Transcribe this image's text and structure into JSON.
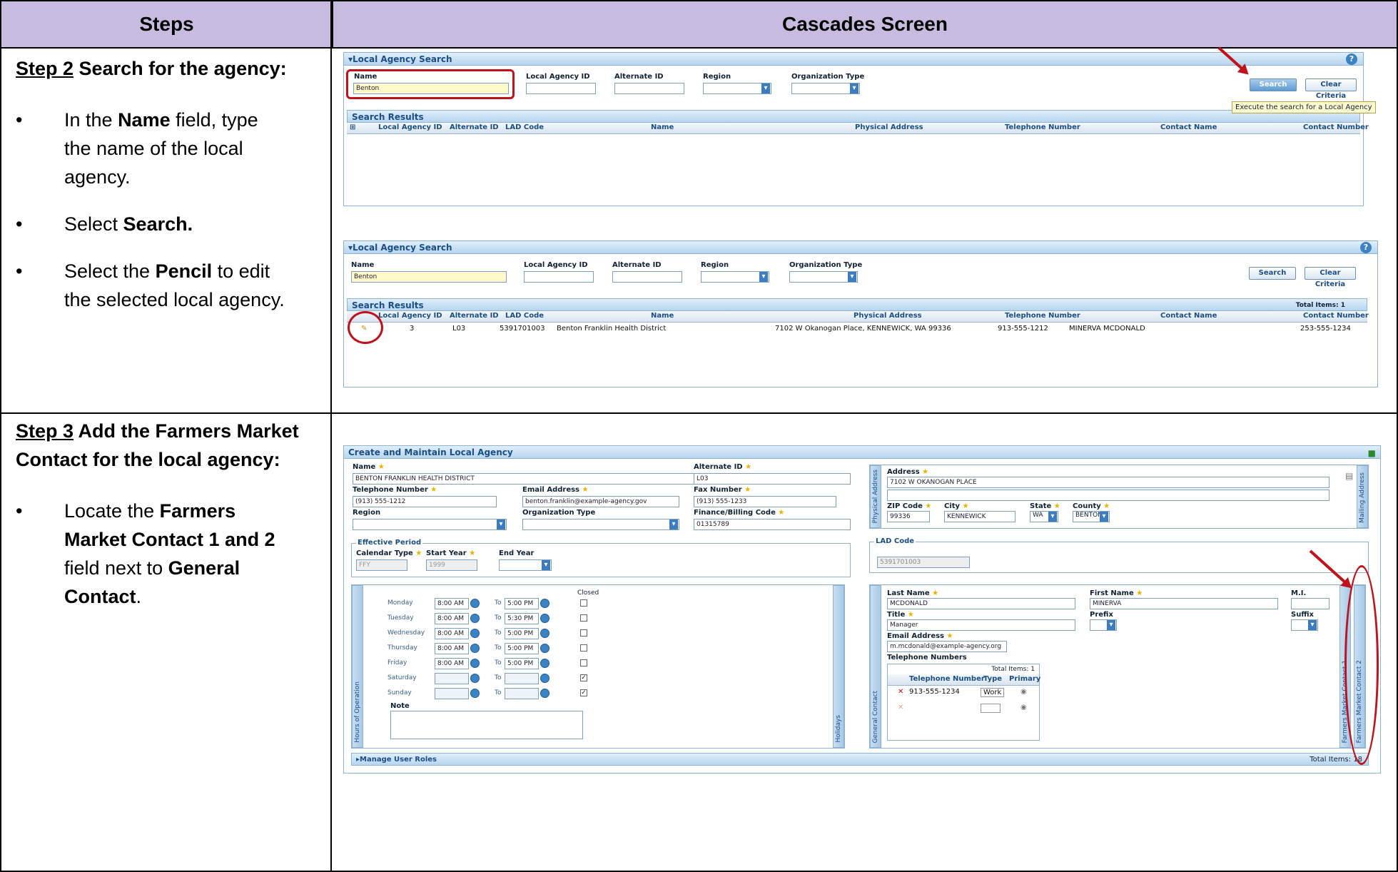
{
  "headers": {
    "steps": "Steps",
    "screen": "Cascades Screen"
  },
  "step2": {
    "label": "Step 2",
    "title": " Search for the agency:",
    "bullets": [
      {
        "pre": "In the ",
        "bold": "Name",
        "post": " field, type the name of the local agency."
      },
      {
        "pre": "Select ",
        "bold": "Search.",
        "post": ""
      },
      {
        "pre": "Select the ",
        "bold": "Pencil",
        "post": " to edit the selected local agency."
      }
    ]
  },
  "step3": {
    "label": "Step 3",
    "title": " Add the Farmers Market Contact for the local agency:",
    "bullet": {
      "pre": "Locate the ",
      "bold1": "Farmers Market Contact 1 and 2",
      "mid": " field next to ",
      "bold2": "General Contact",
      "post": "."
    }
  },
  "search_panel": {
    "title": "▾Local Agency Search",
    "help": "?",
    "labels": {
      "name": "Name",
      "agency_id": "Local Agency ID",
      "alt_id": "Alternate ID",
      "region": "Region",
      "org_type": "Organization Type"
    },
    "name_value": "Benton",
    "search_btn": "Search",
    "clear_btn": "Clear Criteria",
    "results_title": "Search Results",
    "tooltip": "Execute the search for a Local Agency",
    "columns": [
      "Local Agency ID",
      "Alternate ID",
      "LAD Code",
      "Name",
      "Physical Address",
      "Telephone Number",
      "Contact Name",
      "Contact Number"
    ],
    "total": "Total Items: 1",
    "row": {
      "id": "3",
      "alt": "L03",
      "lad": "5391701003",
      "name": "Benton Franklin Health District",
      "address": "7102 W Okanogan Place, KENNEWICK, WA 99336",
      "phone": "913-555-1212",
      "contact": "MINERVA MCDONALD",
      "contact_no": "253-555-1234"
    }
  },
  "maintain": {
    "title": "Create and Maintain Local Agency",
    "name_lbl": "Name",
    "name_val": "BENTON FRANKLIN HEALTH DISTRICT",
    "alt_lbl": "Alternate ID",
    "alt_val": "L03",
    "tel_lbl": "Telephone Number",
    "tel_val": "(913) 555-1212",
    "email_lbl": "Email Address",
    "email_val": "benton.franklin@example-agency.gov",
    "fax_lbl": "Fax Number",
    "fax_val": "(913) 555-1233",
    "region_lbl": "Region",
    "org_lbl": "Organization Type",
    "fin_lbl": "Finance/Billing Code",
    "fin_val": "01315789",
    "eff_lbl": "Effective Period",
    "cal_lbl": "Calendar Type",
    "cal_val": "FFY",
    "start_lbl": "Start Year",
    "start_val": "1999",
    "end_lbl": "End Year",
    "addr_lbl": "Address",
    "addr_val": "7102 W OKANOGAN PLACE",
    "zip_lbl": "ZIP Code",
    "zip_val": "99336",
    "city_lbl": "City",
    "city_val": "KENNEWICK",
    "state_lbl": "State",
    "state_val": "WA",
    "county_lbl": "County",
    "county_val": "BENTON",
    "phys_tab": "Physical Address",
    "mail_tab": "Mailing Address",
    "lad_lbl": "LAD Code",
    "lad_val": "5391701003",
    "hours_tab": "Hours of Operation",
    "holidays_tab": "Holidays",
    "closed_lbl": "Closed",
    "to": "To",
    "note_lbl": "Note",
    "days": [
      {
        "day": "Monday",
        "from": "8:00 AM",
        "to": "5:00 PM",
        "closed": ""
      },
      {
        "day": "Tuesday",
        "from": "8:00 AM",
        "to": "5:30 PM",
        "closed": ""
      },
      {
        "day": "Wednesday",
        "from": "8:00 AM",
        "to": "5:00 PM",
        "closed": ""
      },
      {
        "day": "Thursday",
        "from": "8:00 AM",
        "to": "5:00 PM",
        "closed": ""
      },
      {
        "day": "Friday",
        "from": "8:00 AM",
        "to": "5:00 PM",
        "closed": ""
      },
      {
        "day": "Saturday",
        "from": "",
        "to": "",
        "closed": "✓"
      },
      {
        "day": "Sunday",
        "from": "",
        "to": "",
        "closed": "✓"
      }
    ],
    "gen_tab": "General Contact",
    "last_lbl": "Last Name",
    "last_val": "MCDONALD",
    "first_lbl": "First Name",
    "first_val": "MINERVA",
    "mi_lbl": "M.I.",
    "title_lbl": "Title",
    "title_val": "Manager",
    "prefix_lbl": "Prefix",
    "suffix_lbl": "Suffix",
    "cemail_lbl": "Email Address",
    "cemail_val": "m.mcdonald@example-agency.org",
    "tels_lbl": "Telephone Numbers",
    "tels_total": "Total Items: 1",
    "tel_cols": [
      "Telephone Number",
      "Type",
      "Primary"
    ],
    "tel_row": {
      "num": "913-555-1234",
      "type": "Work"
    },
    "fmc1": "Farmers Market Contact 1",
    "fmc2": "Farmers Market Contact 2",
    "roles": "▸Manage User Roles",
    "roles_total": "Total Items: 18"
  },
  "colors": {
    "header_bg": "#c7bbe0",
    "annotation": "#c0121b",
    "panel_title": "#1c4e86"
  }
}
